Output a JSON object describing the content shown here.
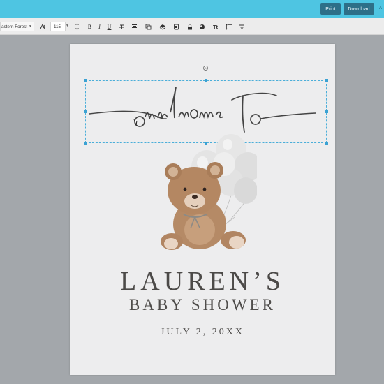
{
  "header": {
    "print_label": "Print",
    "download_label": "Download",
    "edge_text": "A"
  },
  "toolbar": {
    "font_name": "astern Forest",
    "font_size": "115",
    "tools": [
      "B",
      "I",
      "U"
    ]
  },
  "design": {
    "script_text": "welcome to",
    "name": "LAUREN’S",
    "subtitle": "BABY SHOWER",
    "date": "JULY 2, 20XX"
  },
  "colors": {
    "topbar": "#4ec5e2",
    "button": "#2d6f88",
    "selection": "#4aaed9",
    "text": "#4c4a48"
  }
}
